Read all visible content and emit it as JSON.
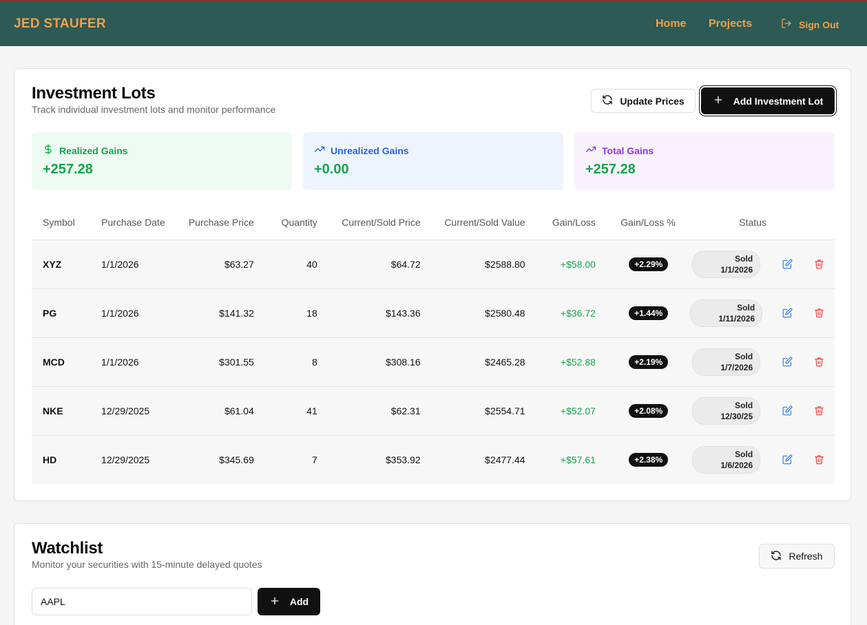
{
  "nav": {
    "brand": "JED STAUFER",
    "links": [
      "Home",
      "Projects"
    ],
    "sign_out": "Sign Out"
  },
  "lots": {
    "title": "Investment Lots",
    "subtitle": "Track individual investment lots and monitor performance",
    "update_prices": "Update Prices",
    "add_lot": "Add Investment Lot",
    "stats": [
      {
        "label": "Realized Gains",
        "value": "+257.28",
        "icon": "dollar-icon",
        "bg": "#eefbf2",
        "color": "#16a34a"
      },
      {
        "label": "Unrealized Gains",
        "value": "+0.00",
        "icon": "trending-up-icon",
        "bg": "#eef4fe",
        "color": "#2563eb"
      },
      {
        "label": "Total Gains",
        "value": "+257.28",
        "icon": "trending-up-icon",
        "bg": "#f9f2fe",
        "color": "#9333ea"
      }
    ],
    "headers": {
      "symbol": "Symbol",
      "purchase_date": "Purchase Date",
      "purchase_price": "Purchase Price",
      "quantity": "Quantity",
      "current_price": "Current/Sold Price",
      "current_value": "Current/Sold Value",
      "gain_loss": "Gain/Loss",
      "gain_loss_pct": "Gain/Loss %",
      "status": "Status"
    },
    "rows": [
      {
        "symbol": "XYZ",
        "date": "1/1/2026",
        "price": "$63.27",
        "qty": "40",
        "cur_price": "$64.72",
        "cur_value": "$2588.80",
        "gain": "+$58.00",
        "pct": "+2.29%",
        "status": "Sold",
        "sold_date": "1/1/2026"
      },
      {
        "symbol": "PG",
        "date": "1/1/2026",
        "price": "$141.32",
        "qty": "18",
        "cur_price": "$143.36",
        "cur_value": "$2580.48",
        "gain": "+$36.72",
        "pct": "+1.44%",
        "status": "Sold",
        "sold_date": "1/11/2026"
      },
      {
        "symbol": "MCD",
        "date": "1/1/2026",
        "price": "$301.55",
        "qty": "8",
        "cur_price": "$308.16",
        "cur_value": "$2465.28",
        "gain": "+$52.88",
        "pct": "+2.19%",
        "status": "Sold",
        "sold_date": "1/7/2026"
      },
      {
        "symbol": "NKE",
        "date": "12/29/2025",
        "price": "$61.04",
        "qty": "41",
        "cur_price": "$62.31",
        "cur_value": "$2554.71",
        "gain": "+$52.07",
        "pct": "+2.08%",
        "status": "Sold",
        "sold_date": "12/30/25"
      },
      {
        "symbol": "HD",
        "date": "12/29/2025",
        "price": "$345.69",
        "qty": "7",
        "cur_price": "$353.92",
        "cur_value": "$2477.44",
        "gain": "+$57.61",
        "pct": "+2.38%",
        "status": "Sold",
        "sold_date": "1/6/2026"
      }
    ]
  },
  "watchlist": {
    "title": "Watchlist",
    "subtitle": "Monitor your securities with 15-minute delayed quotes",
    "refresh": "Refresh",
    "input_value": "AAPL",
    "add": "Add"
  },
  "colors": {
    "nav_bg": "#2d5a54",
    "brand": "#f0a04b",
    "gain": "#16a34a",
    "edit": "#3b82f6",
    "delete": "#ef4444"
  }
}
